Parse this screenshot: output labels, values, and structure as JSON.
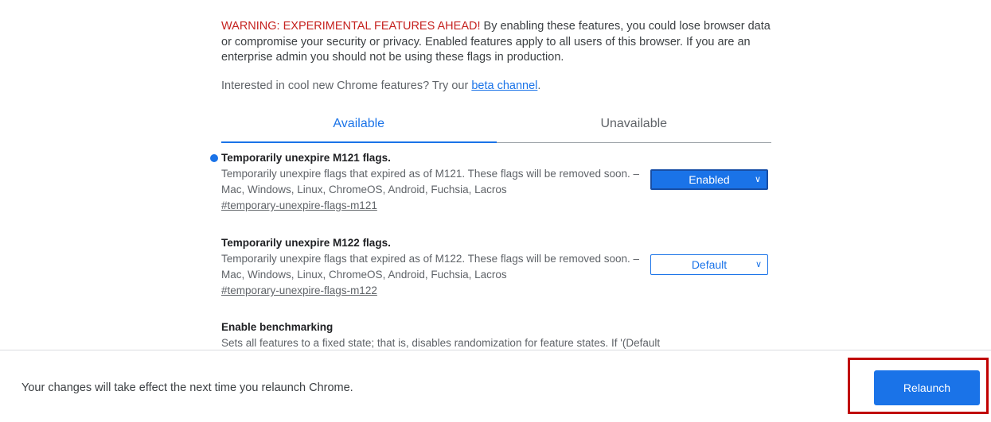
{
  "warning": {
    "label": "WARNING: EXPERIMENTAL FEATURES AHEAD!",
    "text": " By enabling these features, you could lose browser data or compromise your security or privacy. Enabled features apply to all users of this browser. If you are an enterprise admin you should not be using these flags in production."
  },
  "beta": {
    "prefix": "Interested in cool new Chrome features? Try our ",
    "link_text": "beta channel",
    "suffix": "."
  },
  "tabs": [
    {
      "label": "Available",
      "active": true
    },
    {
      "label": "Unavailable",
      "active": false
    }
  ],
  "flags": [
    {
      "title": "Temporarily unexpire M121 flags.",
      "description": "Temporarily unexpire flags that expired as of M121. These flags will be removed soon. – Mac, Windows, Linux, ChromeOS, Android, Fuchsia, Lacros",
      "link": "#temporary-unexpire-flags-m121",
      "value": "Enabled",
      "modified": true
    },
    {
      "title": "Temporarily unexpire M122 flags.",
      "description": "Temporarily unexpire flags that expired as of M122. These flags will be removed soon. – Mac, Windows, Linux, ChromeOS, Android, Fuchsia, Lacros",
      "link": "#temporary-unexpire-flags-m122",
      "value": "Default",
      "modified": false
    },
    {
      "title": "Enable benchmarking",
      "description": "Sets all features to a fixed state; that is, disables randomization for feature states. If '(Default"
    }
  ],
  "footer": {
    "message": "Your changes will take effect the next time you relaunch Chrome.",
    "button_label": "Relaunch"
  },
  "icons": {
    "dropdown": "chevron-down-icon",
    "modified": "modified-dot-icon"
  },
  "colors": {
    "accent": "#1a73e8",
    "warning": "#c5221f",
    "highlight": "#c00000"
  }
}
